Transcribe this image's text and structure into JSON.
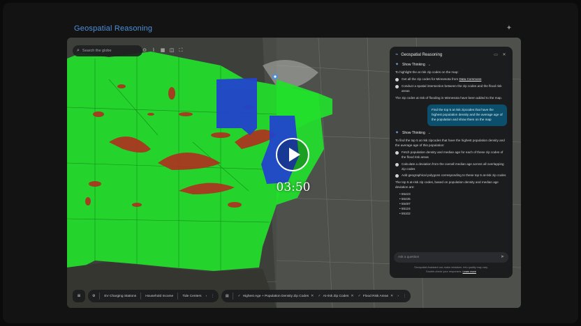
{
  "app": {
    "title": "Geospatial Reasoning"
  },
  "map": {
    "search_placeholder": "Search the globe",
    "tools": [
      "pin-icon",
      "ruler-icon",
      "grid-icon",
      "layers-icon",
      "fullscreen-icon"
    ]
  },
  "chat": {
    "title": "Geospatial Reasoning",
    "thinking_label": "Show Thinking",
    "block1": {
      "intro": "To highlight the at risk zip codes on the map:",
      "step1_pre": "Get all the zip codes for Minnesota from ",
      "step1_link": "Data Commons",
      "step2": "Conduct a spatial intersection between the zip codes and the flood risk areas",
      "result": "The zip codes at risk of flooding in Minnesota have been added to the map."
    },
    "user_message": "Find the top 5 at risk zipcodes that have the highest population density and the average age of the population and show them on the map",
    "block2": {
      "intro": "To find the top 5 at risk zipcodes that have the highest population density and the average age of this population:",
      "step1": "Fetch population density and median age for each of these zip codes of the flood risk areas",
      "step2": "Calculate a deviation from the overall median age across all overlapping zip codes",
      "step3": "Add geographical polygons corresponding to these top 5 at-risk zip codes",
      "result": "The top 5 at-risk zip codes, based on population density and median age deviation are:",
      "zips": [
        "55423",
        "55435",
        "55497",
        "55124",
        "55102"
      ]
    },
    "input_placeholder": "Ask a question",
    "disclaimer_line1": "Geospatial Assistant can make mistakes. Info quality may vary.",
    "disclaimer_line2": "Double-check your responses.",
    "disclaimer_link": "Learn more"
  },
  "layers_bar": {
    "group1": [
      "EV Charging Stations",
      "Household Income",
      "Tide Centers"
    ],
    "group2": [
      "Highest Age + Population Density Zip Codes",
      "At-risk Zip Codes",
      "Flood Risk Areas"
    ]
  },
  "video": {
    "duration": "03:50"
  },
  "colors": {
    "flood_zone": "#22e02b",
    "flood_risk": "#c0392b",
    "highlight_zip": "#2244cc",
    "accent": "#4f8fd6"
  }
}
